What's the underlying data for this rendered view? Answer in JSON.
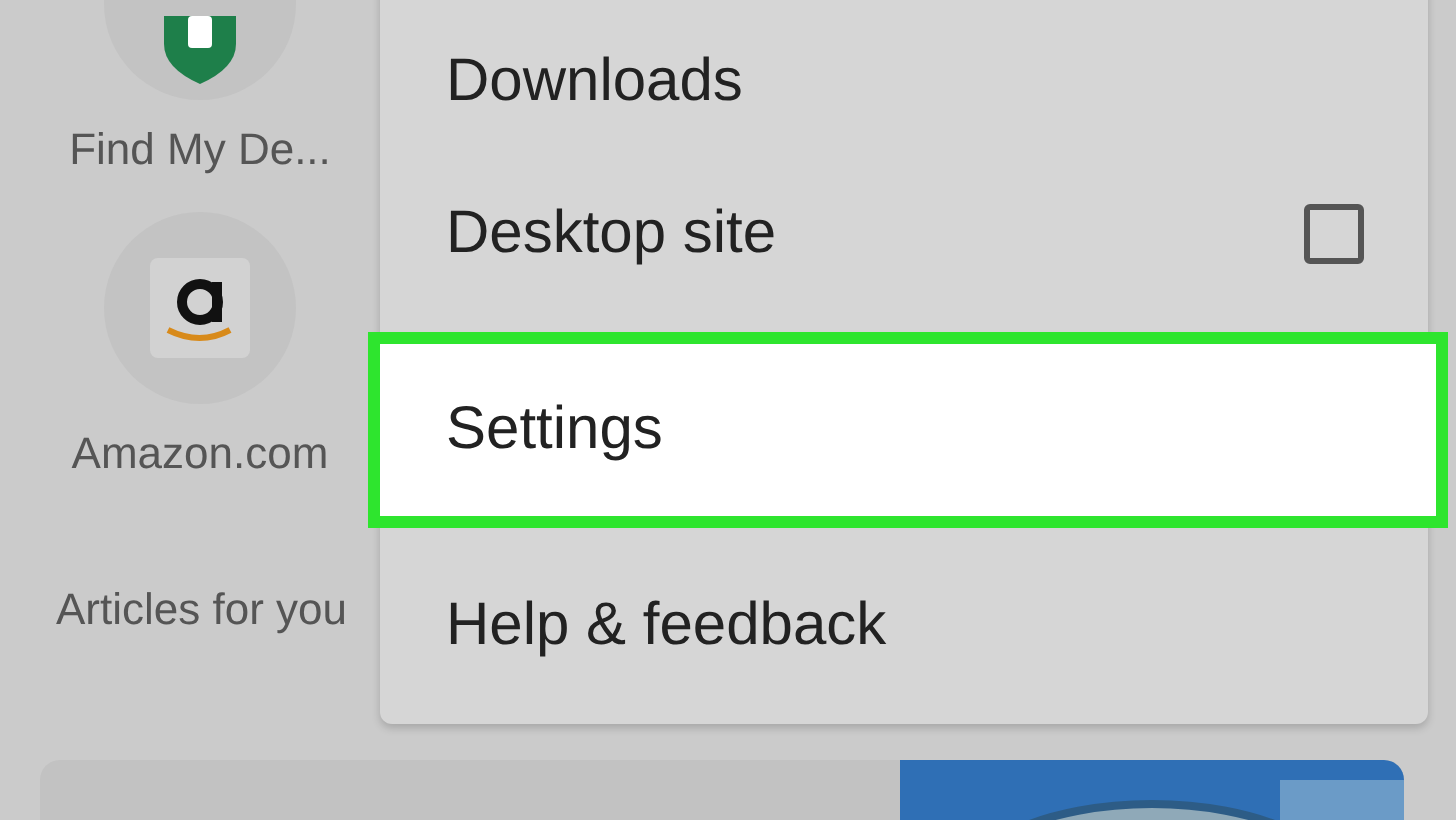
{
  "shortcuts": [
    {
      "label": "Find My De..."
    },
    {
      "label": "Amazon.com"
    }
  ],
  "section_title": "Articles for you",
  "menu": {
    "items": [
      {
        "label": "Downloads",
        "kind": "plain",
        "selected": false
      },
      {
        "label": "Desktop site",
        "kind": "checkbox",
        "checked": false,
        "selected": false
      },
      {
        "label": "Settings",
        "kind": "plain",
        "selected": true
      },
      {
        "label": "Help & feedback",
        "kind": "plain",
        "selected": false
      }
    ]
  }
}
